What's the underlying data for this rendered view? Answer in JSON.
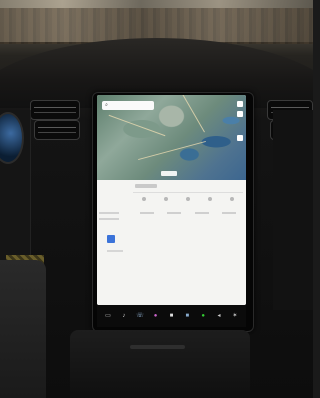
{
  "scene": {
    "type": "photo-of-car-center-touchscreen",
    "screen": {
      "map": {
        "search_icon": "search-icon",
        "controls": [
          "zoom-in-icon",
          "zoom-out-icon",
          "locate-icon"
        ]
      },
      "panel": {
        "accent_color": "#3b73d9"
      },
      "dock": {
        "icons": [
          "car-icon",
          "music-icon",
          "phone-icon",
          "camera-icon",
          "settings-icon",
          "media-icon",
          "green-status-icon",
          "volume-icon",
          "fan-icon"
        ]
      }
    }
  }
}
